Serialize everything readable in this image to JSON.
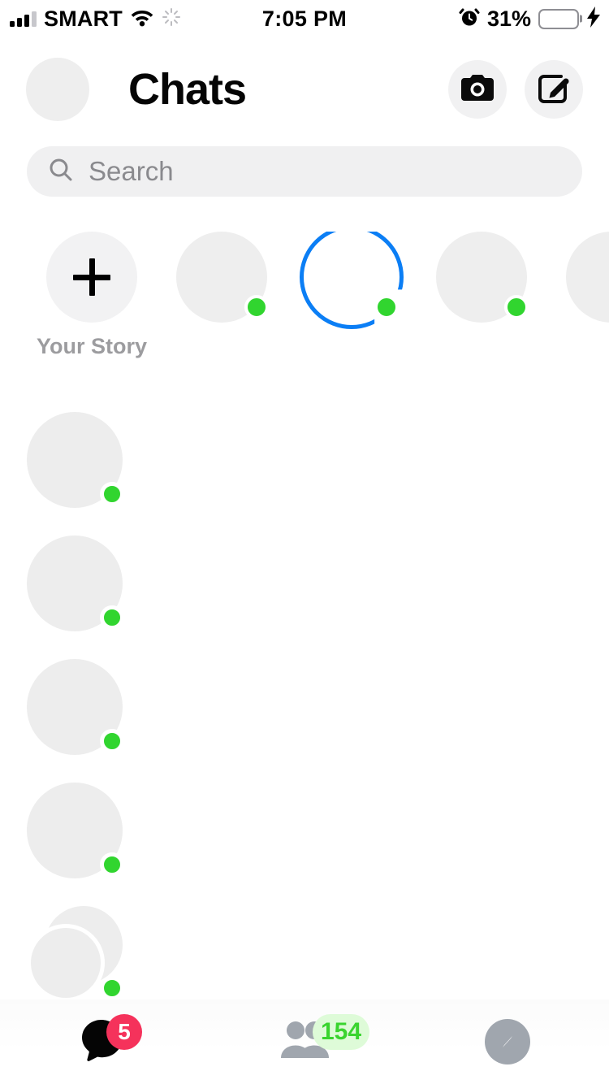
{
  "status_bar": {
    "carrier": "SMART",
    "time": "7:05 PM",
    "battery_percent": "31%",
    "battery_level": 31,
    "icons": [
      "signal-bars-icon",
      "wifi-icon",
      "activity-spinner-icon",
      "alarm-clock-icon",
      "battery-icon",
      "charging-bolt-icon"
    ]
  },
  "header": {
    "title": "Chats",
    "camera_button": "camera-icon",
    "compose_button": "compose-icon",
    "profile_avatar": "profile-avatar"
  },
  "search": {
    "placeholder": "Search",
    "value": "",
    "icon": "search-icon"
  },
  "stories": {
    "items": [
      {
        "name": "Your Story",
        "type": "add",
        "online": false,
        "ring": false,
        "redacted": false
      },
      {
        "name": "",
        "type": "user",
        "online": true,
        "ring": false,
        "redacted": true
      },
      {
        "name": "",
        "type": "user",
        "online": true,
        "ring": true,
        "redacted": true
      },
      {
        "name": "",
        "type": "user",
        "online": true,
        "ring": false,
        "redacted": true
      },
      {
        "name": "",
        "type": "user",
        "online": true,
        "ring": false,
        "redacted": true
      }
    ]
  },
  "chats": {
    "rows": [
      {
        "name": "",
        "message": "",
        "time": "",
        "online": true,
        "group": false
      },
      {
        "name": "",
        "message": "",
        "time": "",
        "online": true,
        "group": false
      },
      {
        "name": "",
        "message": "",
        "time": "",
        "online": true,
        "group": false
      },
      {
        "name": "",
        "message": "",
        "time": "",
        "online": true,
        "group": false
      },
      {
        "name": "",
        "message": "",
        "time": "",
        "online": true,
        "group": true
      }
    ]
  },
  "tabbar": {
    "tabs": [
      {
        "id": "chats",
        "icon": "chat-bubble-icon",
        "badge": "5",
        "badge_style": "red",
        "active": true
      },
      {
        "id": "people",
        "icon": "people-icon",
        "badge": "154",
        "badge_style": "green",
        "active": false
      },
      {
        "id": "discover",
        "icon": "compass-icon",
        "badge": "",
        "badge_style": "",
        "active": false
      }
    ]
  },
  "colors": {
    "online_green": "#31d52f",
    "story_ring_blue": "#0b7ef5",
    "badge_red": "#f5325b",
    "badge_green_text": "#3ad42f",
    "badge_green_bg": "#defbd8",
    "battery_yellow": "#ffcc00"
  }
}
